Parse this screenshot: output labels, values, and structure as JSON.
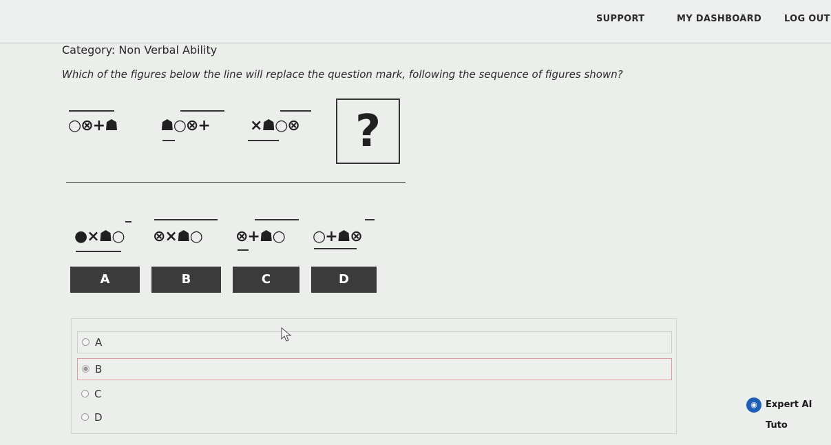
{
  "nav": {
    "support": "SUPPORT",
    "dashboard": "MY DASHBOARD",
    "logout": "LOG OUT"
  },
  "category": "Category: Non Verbal Ability",
  "question": "Which of the figures below the line will replace the question mark, following the sequence of figures shown?",
  "problem_figures": [
    {
      "symbols": "○⊗+☗"
    },
    {
      "symbols": "☗○⊗+"
    },
    {
      "symbols": "×☗○⊗"
    }
  ],
  "unknown_marker": "?",
  "answer_figures": [
    {
      "symbols": "●×☗○",
      "label": "A"
    },
    {
      "symbols": "⊗×☗○",
      "label": "B"
    },
    {
      "symbols": "⊗+☗○",
      "label": "C"
    },
    {
      "symbols": "○+☗⊗",
      "label": "D"
    }
  ],
  "choices": [
    {
      "label": "A",
      "selected": false
    },
    {
      "label": "B",
      "selected": true
    },
    {
      "label": "C",
      "selected": false
    },
    {
      "label": "D",
      "selected": false
    }
  ],
  "tutor": {
    "icon": "tutor-icon",
    "label": "Expert AI Tuto"
  },
  "colors": {
    "nav_bg": "#eef0ef",
    "label_bg": "#3b3b3b",
    "tutor_blue": "#1d5fb8",
    "selected_border": "#e09aa2"
  }
}
